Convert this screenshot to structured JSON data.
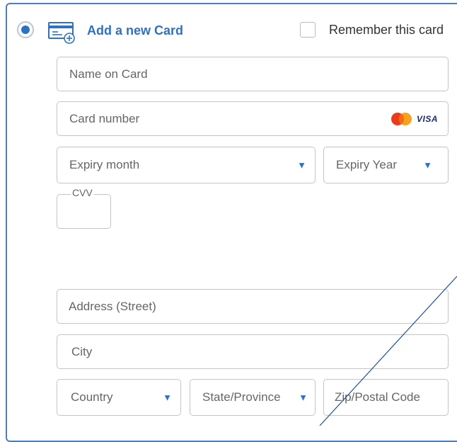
{
  "header": {
    "title": "Add a new Card",
    "remember_label": "Remember this card",
    "radio_selected": true,
    "remember_checked": false
  },
  "fields": {
    "name_on_card": {
      "placeholder": "Name on Card",
      "value": ""
    },
    "card_number": {
      "placeholder": "Card number",
      "value": ""
    },
    "expiry_month": {
      "selected": "Expiry month"
    },
    "expiry_year": {
      "selected": "Expiry Year"
    },
    "cvv": {
      "label": "CVV",
      "value": ""
    },
    "address_street": {
      "placeholder": "Address (Street)",
      "value": ""
    },
    "city": {
      "placeholder": "City",
      "value": ""
    },
    "country": {
      "selected": "Country"
    },
    "state_province": {
      "selected": "State/Province"
    },
    "zip_postal": {
      "placeholder": "Zip/Postal Code",
      "value": ""
    }
  },
  "card_brands": {
    "visa_text": "VISA",
    "mastercard_icon": "mastercard-icon"
  },
  "icons": {
    "dropdown": "▼",
    "add_card": "card-add-icon"
  },
  "colors": {
    "accent": "#2f71c4",
    "border": "#4a7fc1",
    "field_border": "#c4c4c4",
    "mastercard_red": "#eb3b1f",
    "mastercard_orange": "#f6a21b",
    "visa_blue": "#1b2a7a"
  }
}
